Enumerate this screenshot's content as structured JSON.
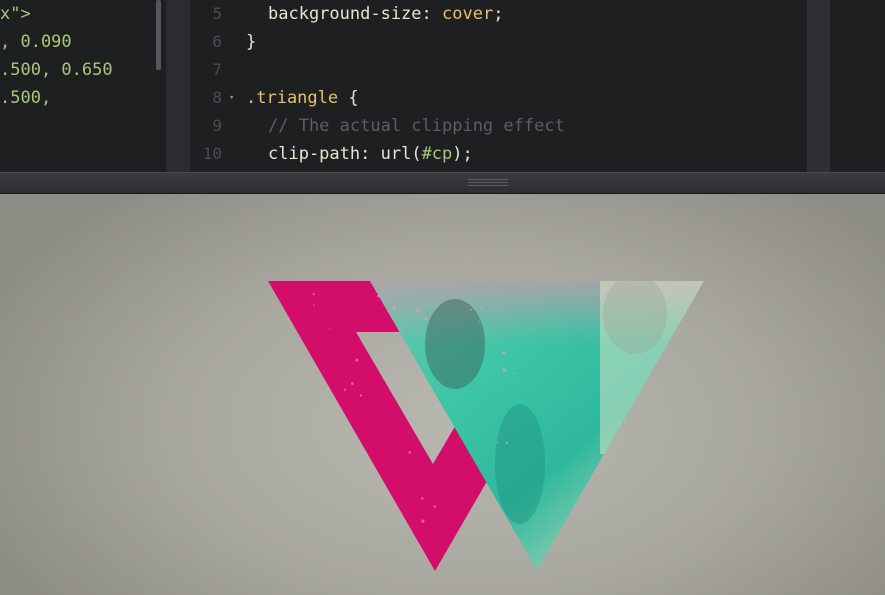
{
  "html_editor": {
    "lines": [
      {
        "parts": [
          {
            "t": "x\">",
            "c": "c-str"
          }
        ]
      },
      {
        "parts": [
          {
            "t": ", 0.090",
            "c": "c-str"
          }
        ]
      },
      {
        "parts": [
          {
            "t": ".500, 0.650",
            "c": "c-str"
          }
        ]
      },
      {
        "parts": [
          {
            "t": ".500,",
            "c": "c-str"
          }
        ]
      }
    ]
  },
  "css_editor": {
    "lines": [
      {
        "num": "5",
        "fold": "",
        "indent": 1,
        "parts": [
          {
            "t": "background-size",
            "c": "c-attr"
          },
          {
            "t": ": ",
            "c": "c-attr"
          },
          {
            "t": "cover",
            "c": "c-val"
          },
          {
            "t": ";",
            "c": "c-attr"
          }
        ]
      },
      {
        "num": "6",
        "fold": "",
        "indent": 0,
        "parts": [
          {
            "t": "}",
            "c": "c-brace"
          }
        ]
      },
      {
        "num": "7",
        "fold": "",
        "indent": 0,
        "parts": []
      },
      {
        "num": "8",
        "fold": "▾",
        "indent": 0,
        "parts": [
          {
            "t": ".triangle",
            "c": "c-sel"
          },
          {
            "t": " {",
            "c": "c-brace"
          }
        ]
      },
      {
        "num": "9",
        "fold": "",
        "indent": 1,
        "parts": [
          {
            "t": "// The actual clipping effect",
            "c": "c-comm"
          }
        ]
      },
      {
        "num": "10",
        "fold": "",
        "indent": 1,
        "parts": [
          {
            "t": "clip-path",
            "c": "c-prop"
          },
          {
            "t": ": ",
            "c": "c-prop"
          },
          {
            "t": "url(",
            "c": "c-fn"
          },
          {
            "t": "#cp",
            "c": "c-hash"
          },
          {
            "t": ");",
            "c": "c-fn"
          }
        ]
      }
    ]
  },
  "preview": {
    "triangles": [
      {
        "name": "magenta-triangle",
        "color": "#d20d6a"
      },
      {
        "name": "photo-triangle",
        "color": "#38c4a8"
      }
    ]
  }
}
